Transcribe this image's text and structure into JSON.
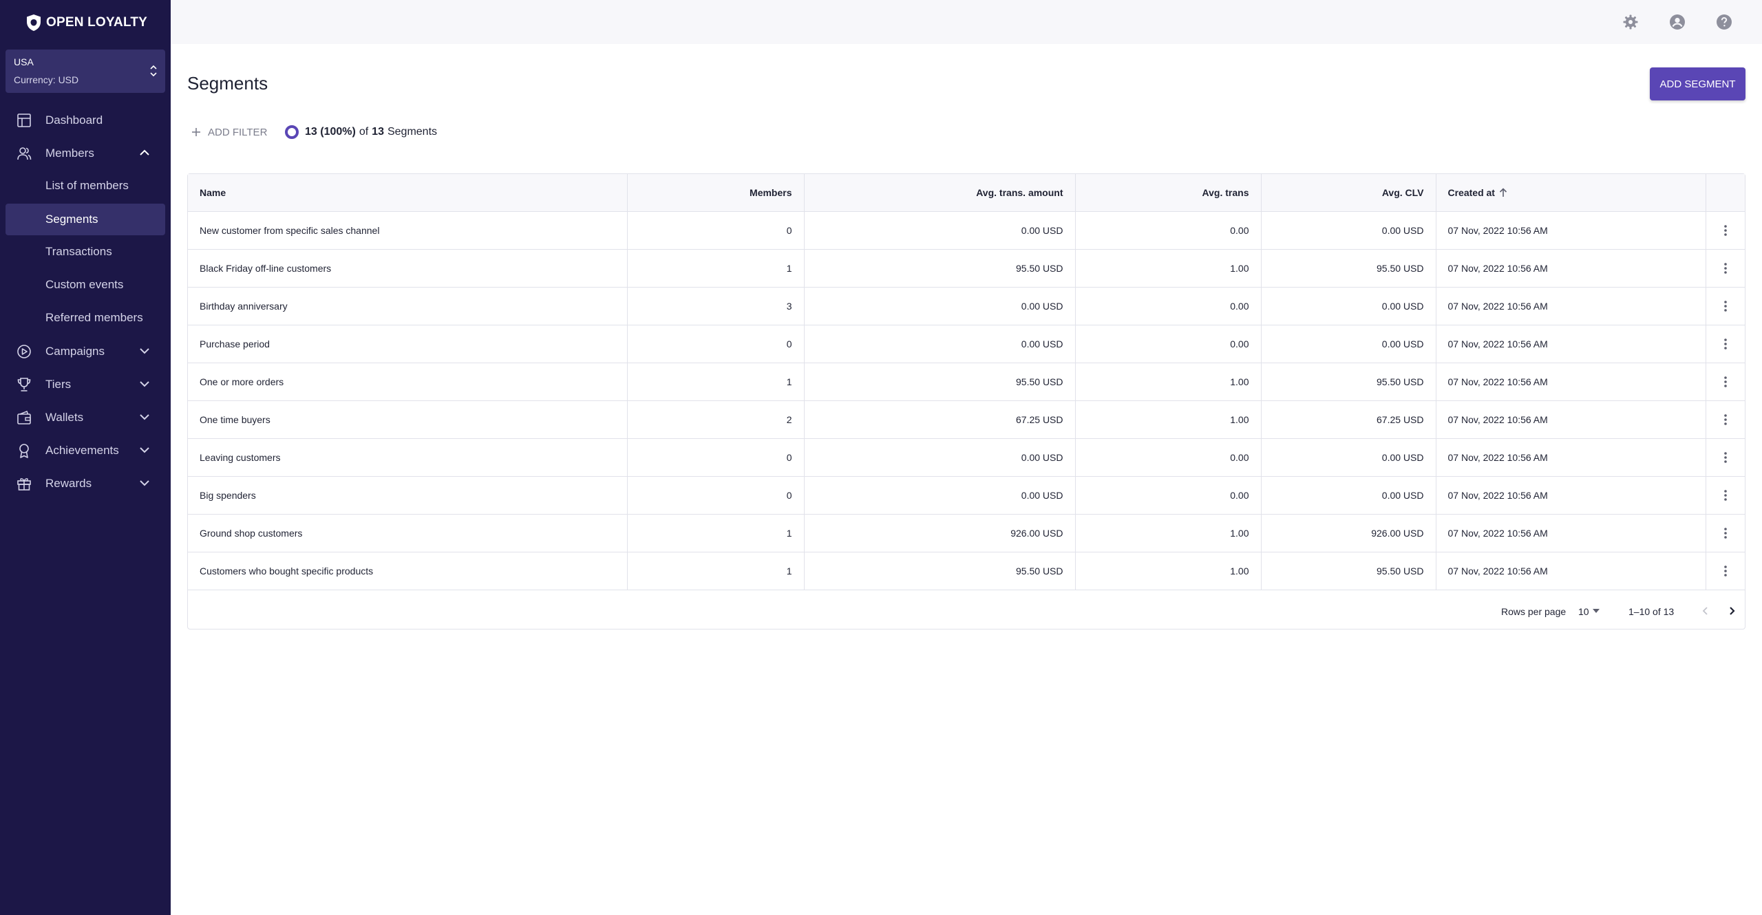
{
  "app": {
    "brand": "OPEN LOYALTY"
  },
  "store": {
    "name": "USA",
    "currency": "Currency: USD"
  },
  "sidebar": {
    "items": [
      {
        "label": "Dashboard",
        "icon": "dashboard-icon"
      },
      {
        "label": "Members",
        "icon": "members-icon",
        "expanded": true
      },
      {
        "label": "Campaigns",
        "icon": "campaigns-icon"
      },
      {
        "label": "Tiers",
        "icon": "trophy-icon"
      },
      {
        "label": "Wallets",
        "icon": "wallet-icon"
      },
      {
        "label": "Achievements",
        "icon": "achievement-icon"
      },
      {
        "label": "Rewards",
        "icon": "gift-icon"
      }
    ],
    "members_sub": [
      {
        "label": "List of members"
      },
      {
        "label": "Segments",
        "active": true
      },
      {
        "label": "Transactions"
      },
      {
        "label": "Custom events"
      },
      {
        "label": "Referred members"
      }
    ]
  },
  "topbar": {
    "icons": [
      "settings-icon",
      "account-icon",
      "help-icon"
    ]
  },
  "page": {
    "title": "Segments",
    "add_button": "ADD SEGMENT"
  },
  "filters": {
    "add_label": "ADD FILTER",
    "count_bold": "13 (100%)",
    "count_of": "of",
    "count_total": "13",
    "count_suffix": "Segments"
  },
  "table": {
    "columns": [
      "Name",
      "Members",
      "Avg. trans. amount",
      "Avg. trans",
      "Avg. CLV",
      "Created at"
    ],
    "sorted_column": "Created at",
    "rows": [
      {
        "name": "New customer from specific sales channel",
        "members": "0",
        "avg_amount": "0.00 USD",
        "avg_trans": "0.00",
        "avg_clv": "0.00 USD",
        "created": "07 Nov, 2022 10:56 AM"
      },
      {
        "name": "Black Friday off-line customers",
        "members": "1",
        "avg_amount": "95.50 USD",
        "avg_trans": "1.00",
        "avg_clv": "95.50 USD",
        "created": "07 Nov, 2022 10:56 AM"
      },
      {
        "name": "Birthday anniversary",
        "members": "3",
        "avg_amount": "0.00 USD",
        "avg_trans": "0.00",
        "avg_clv": "0.00 USD",
        "created": "07 Nov, 2022 10:56 AM"
      },
      {
        "name": "Purchase period",
        "members": "0",
        "avg_amount": "0.00 USD",
        "avg_trans": "0.00",
        "avg_clv": "0.00 USD",
        "created": "07 Nov, 2022 10:56 AM"
      },
      {
        "name": "One or more orders",
        "members": "1",
        "avg_amount": "95.50 USD",
        "avg_trans": "1.00",
        "avg_clv": "95.50 USD",
        "created": "07 Nov, 2022 10:56 AM"
      },
      {
        "name": "One time buyers",
        "members": "2",
        "avg_amount": "67.25 USD",
        "avg_trans": "1.00",
        "avg_clv": "67.25 USD",
        "created": "07 Nov, 2022 10:56 AM"
      },
      {
        "name": "Leaving customers",
        "members": "0",
        "avg_amount": "0.00 USD",
        "avg_trans": "0.00",
        "avg_clv": "0.00 USD",
        "created": "07 Nov, 2022 10:56 AM"
      },
      {
        "name": "Big spenders",
        "members": "0",
        "avg_amount": "0.00 USD",
        "avg_trans": "0.00",
        "avg_clv": "0.00 USD",
        "created": "07 Nov, 2022 10:56 AM"
      },
      {
        "name": "Ground shop customers",
        "members": "1",
        "avg_amount": "926.00 USD",
        "avg_trans": "1.00",
        "avg_clv": "926.00 USD",
        "created": "07 Nov, 2022 10:56 AM"
      },
      {
        "name": "Customers who bought specific products",
        "members": "1",
        "avg_amount": "95.50 USD",
        "avg_trans": "1.00",
        "avg_clv": "95.50 USD",
        "created": "07 Nov, 2022 10:56 AM"
      }
    ]
  },
  "pagination": {
    "rows_per_page_label": "Rows per page",
    "rows_per_page": "10",
    "range": "1–10 of 13"
  },
  "colors": {
    "sidebar_bg": "#1c1747",
    "accent": "#5a46b5",
    "active_item": "#35306a"
  }
}
